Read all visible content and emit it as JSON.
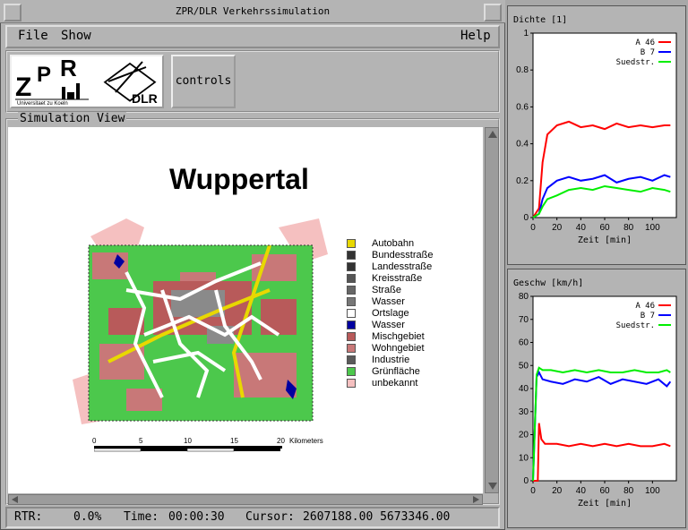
{
  "window": {
    "title": "ZPR/DLR Verkehrssimulation"
  },
  "menu": {
    "file": "File",
    "show": "Show",
    "help": "Help"
  },
  "toolbar": {
    "logo_zpr": "ZPR",
    "logo_uni": "Universitaet zu Koeln",
    "logo_dlr": "DLR",
    "controls_label": "controls"
  },
  "sim_view": {
    "title": "Simulation View",
    "map_title": "Wuppertal",
    "legend": [
      {
        "label": "Autobahn",
        "color": "#e8d800"
      },
      {
        "label": "Bundesstraße",
        "color": "#333333"
      },
      {
        "label": "Landesstraße",
        "color": "#333333"
      },
      {
        "label": "Kreisstraße",
        "color": "#555555"
      },
      {
        "label": "Straße",
        "color": "#666666"
      },
      {
        "label": "Wasser",
        "color": "#777777"
      },
      {
        "label": "Ortslage",
        "color": "#ffffff"
      },
      {
        "label": "Wasser",
        "color": "#0000a0"
      },
      {
        "label": "Mischgebiet",
        "color": "#b85a5a"
      },
      {
        "label": "Wohngebiet",
        "color": "#c87878"
      },
      {
        "label": "Industrie",
        "color": "#5a5a5a"
      },
      {
        "label": "Grünfläche",
        "color": "#4cc84c"
      },
      {
        "label": "unbekannt",
        "color": "#f5c0c0"
      }
    ],
    "scale_ticks": [
      "0",
      "5",
      "10",
      "15",
      "20"
    ],
    "scale_unit": "Kilometers"
  },
  "status": {
    "rtr_label": "RTR:",
    "rtr_value": "0.0%",
    "time_label": "Time:",
    "time_value": "00:00:30",
    "cursor_label": "Cursor:",
    "cursor_value": "2607188.00 5673346.00"
  },
  "chart_data": [
    {
      "type": "line",
      "title": "Dichte [1]",
      "xlabel": "Zeit [min]",
      "xlim": [
        0,
        120
      ],
      "ylim": [
        0,
        1
      ],
      "xticks": [
        "0",
        "20",
        "40",
        "60",
        "80",
        "100"
      ],
      "yticks": [
        "0",
        "0.2",
        "0.4",
        "0.6",
        "0.8",
        "1"
      ],
      "legend_position": "top-right",
      "series": [
        {
          "name": "A 46",
          "color": "#ff0000",
          "x": [
            0,
            5,
            8,
            12,
            20,
            30,
            40,
            50,
            60,
            70,
            80,
            90,
            100,
            110,
            115
          ],
          "values": [
            0,
            0.05,
            0.3,
            0.45,
            0.5,
            0.52,
            0.49,
            0.5,
            0.48,
            0.51,
            0.49,
            0.5,
            0.49,
            0.5,
            0.5
          ]
        },
        {
          "name": "B 7",
          "color": "#0000ff",
          "x": [
            0,
            5,
            8,
            12,
            20,
            30,
            40,
            50,
            60,
            70,
            80,
            90,
            100,
            110,
            115
          ],
          "values": [
            0,
            0.02,
            0.1,
            0.16,
            0.2,
            0.22,
            0.2,
            0.21,
            0.23,
            0.19,
            0.21,
            0.22,
            0.2,
            0.23,
            0.22
          ]
        },
        {
          "name": "Suedstr.",
          "color": "#00ee00",
          "x": [
            0,
            5,
            8,
            12,
            20,
            30,
            40,
            50,
            60,
            70,
            80,
            90,
            100,
            110,
            115
          ],
          "values": [
            0,
            0.02,
            0.06,
            0.1,
            0.12,
            0.15,
            0.16,
            0.15,
            0.17,
            0.16,
            0.15,
            0.14,
            0.16,
            0.15,
            0.14
          ]
        }
      ]
    },
    {
      "type": "line",
      "title": "Geschw [km/h]",
      "xlabel": "Zeit [min]",
      "xlim": [
        0,
        120
      ],
      "ylim": [
        0,
        80
      ],
      "xticks": [
        "0",
        "20",
        "40",
        "60",
        "80",
        "100"
      ],
      "yticks": [
        "0",
        "10",
        "20",
        "30",
        "40",
        "50",
        "60",
        "70",
        "80"
      ],
      "legend_position": "top-right",
      "series": [
        {
          "name": "A 46",
          "color": "#ff0000",
          "x": [
            0,
            4,
            5,
            7,
            10,
            20,
            30,
            40,
            50,
            60,
            70,
            80,
            90,
            100,
            110,
            115
          ],
          "values": [
            0,
            0,
            25,
            18,
            16,
            16,
            15,
            16,
            15,
            16,
            15,
            16,
            15,
            15,
            16,
            15
          ]
        },
        {
          "name": "B 7",
          "color": "#0000ff",
          "x": [
            0,
            3,
            5,
            8,
            15,
            25,
            35,
            45,
            55,
            65,
            75,
            85,
            95,
            105,
            112,
            115
          ],
          "values": [
            0,
            45,
            47,
            44,
            43,
            42,
            44,
            43,
            45,
            42,
            44,
            43,
            42,
            44,
            41,
            43
          ]
        },
        {
          "name": "Suedstr.",
          "color": "#00ee00",
          "x": [
            0,
            3,
            5,
            8,
            15,
            25,
            35,
            45,
            55,
            65,
            75,
            85,
            95,
            105,
            112,
            115
          ],
          "values": [
            0,
            46,
            49,
            48,
            48,
            47,
            48,
            47,
            48,
            47,
            47,
            48,
            47,
            47,
            48,
            47
          ]
        }
      ]
    }
  ]
}
